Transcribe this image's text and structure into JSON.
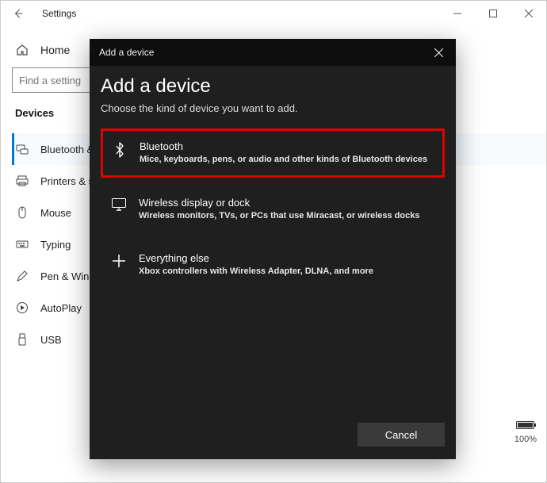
{
  "window": {
    "title": "Settings"
  },
  "settings": {
    "home": "Home",
    "search_placeholder": "Find a setting",
    "section": "Devices",
    "nav": [
      {
        "label": "Bluetooth & other devices"
      },
      {
        "label": "Printers & scanners"
      },
      {
        "label": "Mouse"
      },
      {
        "label": "Typing"
      },
      {
        "label": "Pen & Windows Ink"
      },
      {
        "label": "AutoPlay"
      },
      {
        "label": "USB"
      }
    ]
  },
  "battery": {
    "percent": "100%"
  },
  "modal": {
    "titlebar": "Add a device",
    "heading": "Add a device",
    "subheading": "Choose the kind of device you want to add.",
    "options": [
      {
        "title": "Bluetooth",
        "desc": "Mice, keyboards, pens, or audio and other kinds of Bluetooth devices"
      },
      {
        "title": "Wireless display or dock",
        "desc": "Wireless monitors, TVs, or PCs that use Miracast, or wireless docks"
      },
      {
        "title": "Everything else",
        "desc": "Xbox controllers with Wireless Adapter, DLNA, and more"
      }
    ],
    "cancel": "Cancel"
  }
}
